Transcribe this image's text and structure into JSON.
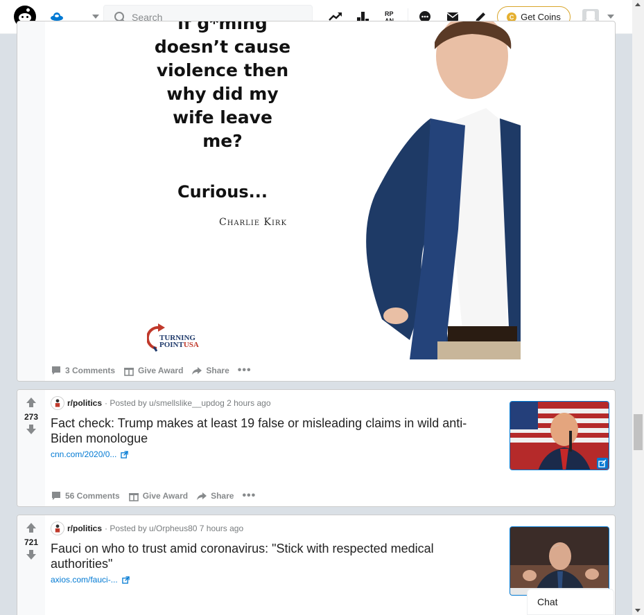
{
  "header": {
    "search_placeholder": "Search",
    "get_coins_label": "Get Coins",
    "coin_glyph": "C",
    "icons": [
      "reddit-logo-icon",
      "home-feed-icon",
      "trending-icon",
      "leaderboard-icon",
      "rpan-icon",
      "chat-icon",
      "mail-icon",
      "create-post-icon"
    ]
  },
  "posts": [
    {
      "image_text": {
        "lines": [
          "if g*ming",
          "doesn’t cause",
          "violence then",
          "why did my",
          "wife leave",
          "me?"
        ],
        "curious": "Curious...",
        "author": "Charlie Kirk",
        "org_line1": "TURNING",
        "org_line2": "POINT",
        "org_line3": "USA"
      },
      "actions": {
        "comments": "3 Comments",
        "award": "Give Award",
        "share": "Share",
        "more": "•••"
      }
    },
    {
      "score": "273",
      "subreddit": "r/politics",
      "posted_by": "· Posted by u/smellslike__updog 2 hours ago",
      "title": "Fact check: Trump makes at least 19 false or misleading claims in wild anti-Biden monologue",
      "link": "cnn.com/2020/0...",
      "actions": {
        "comments": "56 Comments",
        "award": "Give Award",
        "share": "Share",
        "more": "•••"
      }
    },
    {
      "score": "721",
      "subreddit": "r/politics",
      "posted_by": "· Posted by u/Orpheus80 7 hours ago",
      "title": "Fauci on who to trust amid coronavirus: \"Stick with respected medical authorities\"",
      "link": "axios.com/fauci-..."
    }
  ],
  "chat": {
    "label": "Chat"
  },
  "colors": {
    "accent": "#0079d3",
    "coin": "#e5b031",
    "muted": "#878a8c"
  }
}
